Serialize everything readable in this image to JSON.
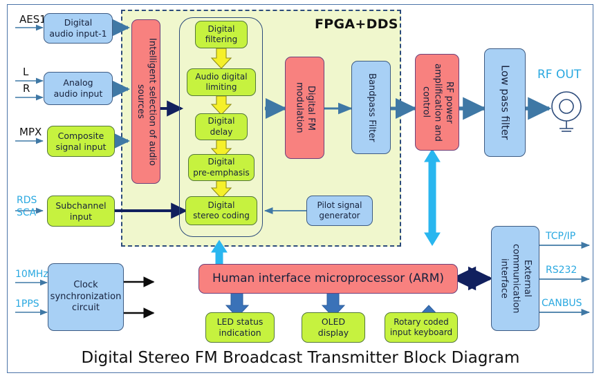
{
  "diagram": {
    "title": "Digital Stereo FM Broadcast Transmitter Block Diagram",
    "fpga_region_label": "FPGA+DDS",
    "colors": {
      "blue_block": "#a8d0f5",
      "green_block": "#c6f23f",
      "red_block": "#f8817f",
      "fpga_background": "#f0f7cd",
      "yellow_arrow": "#f5f02a",
      "cyan_arrow": "#29b6ef",
      "dark_blue_arrow": "#11205e",
      "steel_arrow": "#3f78a5",
      "frame_border": "#4a73a8",
      "cyan_text": "#29a8e0"
    }
  },
  "input_labels": {
    "aes1": "AES1",
    "left": "L",
    "right": "R",
    "mpx": "MPX",
    "rds": "RDS",
    "sca": "SCA",
    "clock_10mhz": "10MHz",
    "clock_1pps": "1PPS"
  },
  "output_labels": {
    "rf_out": "RF OUT",
    "tcpip": "TCP/IP",
    "rs232": "RS232",
    "canbus": "CANBUS"
  },
  "blocks": {
    "digital_audio_input": "Digital\naudio input-1",
    "analog_audio_input": "Analog\naudio input",
    "composite_signal_input": "Composite\nsignal input",
    "subchannel_input": "Subchannel\ninput",
    "intelligent_selection": "Intelligent selection of audio sources",
    "digital_filtering": "Digital\nfiltering",
    "audio_digital_limiting": "Audio digital\nlimiting",
    "digital_delay": "Digital\ndelay",
    "digital_pre_emphasis": "Digital\npre-emphasis",
    "digital_stereo_coding": "Digital\nstereo coding",
    "pilot_signal_generator": "Pilot signal\ngenerator",
    "digital_fm_modulation": "Digital FM modulation",
    "bandpass_filter": "Bandpass Filter",
    "rf_power_amplification": "RF power amplification and control",
    "low_pass_filter": "Low pass filter",
    "clock_sync": "Clock\nsynchronization\ncircuit",
    "human_interface_mcu": "Human interface microprocessor (ARM)",
    "led_status": "LED status\nindication",
    "oled_display": "OLED\ndisplay",
    "rotary_keyboard": "Rotary coded\ninput keyboard",
    "external_comm": "External communication interface"
  }
}
